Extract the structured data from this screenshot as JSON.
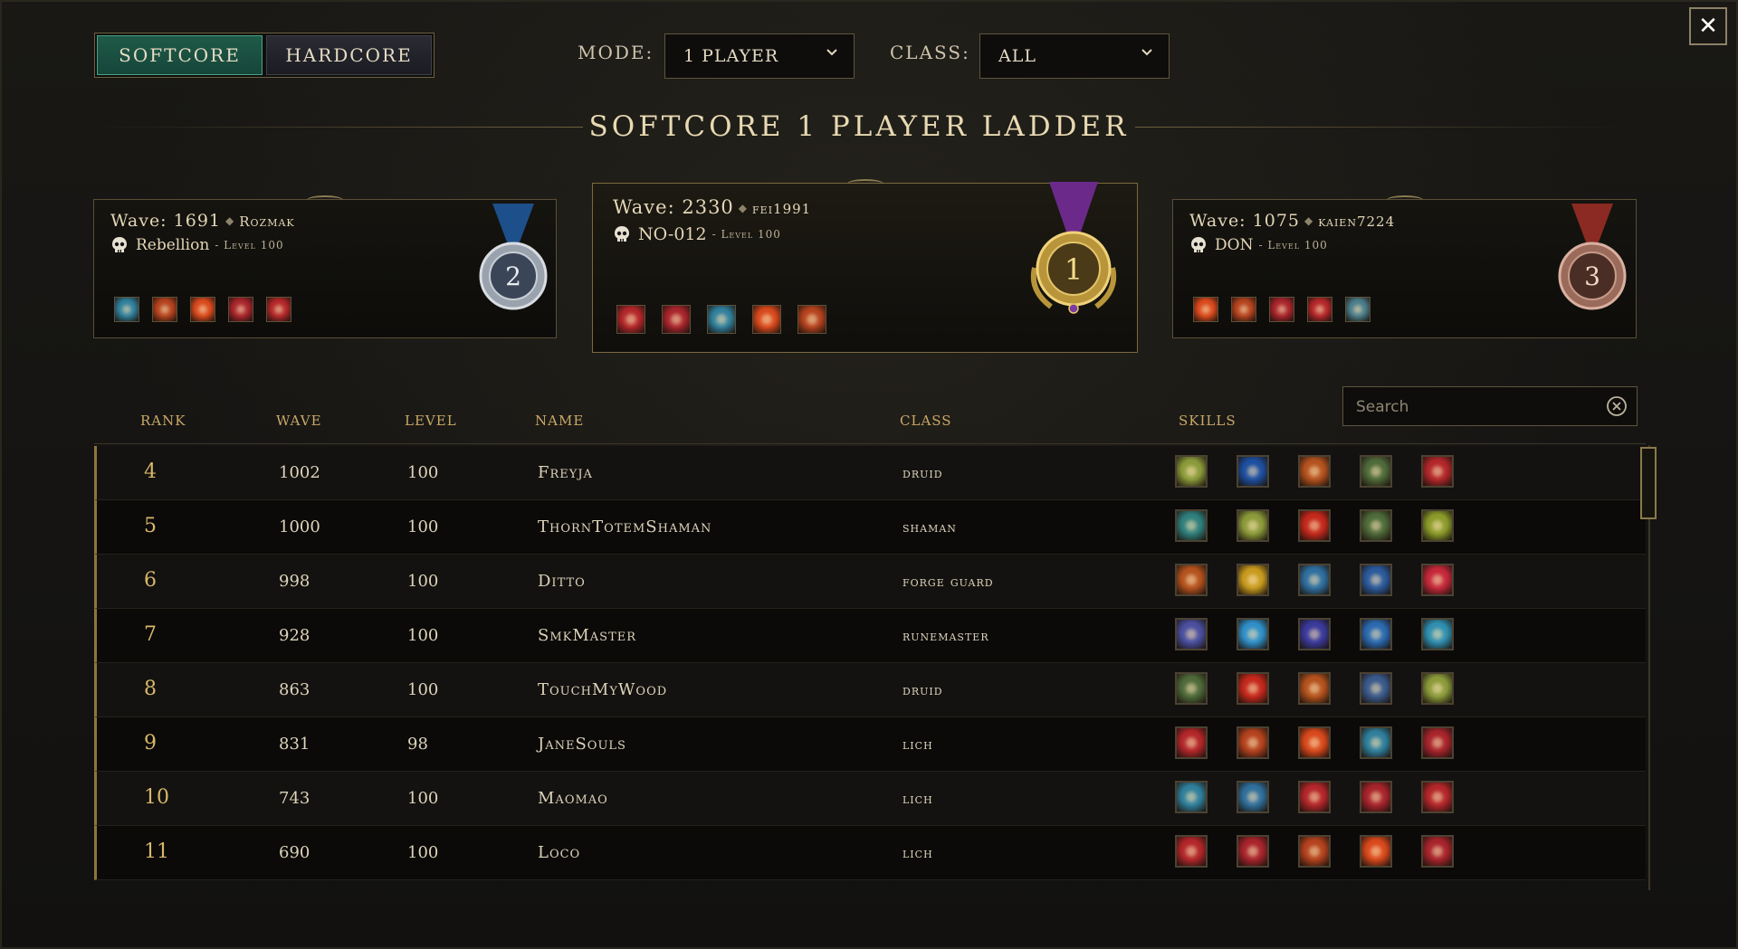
{
  "close_label": "✕",
  "mode_toggle": {
    "softcore": "SOFTCORE",
    "hardcore": "HARDCORE",
    "active": "softcore"
  },
  "filters": {
    "mode": {
      "label": "MODE:",
      "value": "1 PLAYER"
    },
    "class": {
      "label": "CLASS:",
      "value": "ALL"
    }
  },
  "ladder_title": "SOFTCORE 1 PLAYER LADDER",
  "podium": {
    "first": {
      "place": "1",
      "wave_label": "Wave:",
      "wave": "2330",
      "account": "fei1991",
      "character": "NO-012",
      "level": "- Level 100",
      "medal_color": "#6b2a8a",
      "skills": [
        "#b3262a",
        "#a8242c",
        "#2f7f9c",
        "#d8481c",
        "#b4421e"
      ]
    },
    "second": {
      "place": "2",
      "wave_label": "Wave:",
      "wave": "1691",
      "account": "Rozmak",
      "character": "Rebellion",
      "level": "- Level 100",
      "medal_color": "#1d4f8a",
      "skills": [
        "#2f7f9c",
        "#b4421e",
        "#d8481c",
        "#a8242c",
        "#b3262a"
      ]
    },
    "third": {
      "place": "3",
      "wave_label": "Wave:",
      "wave": "1075",
      "account": "kaien7224",
      "character": "DON",
      "level": "- Level 100",
      "medal_color": "#8a2a22",
      "skills": [
        "#d8481c",
        "#b4421e",
        "#a8242c",
        "#b3262a",
        "#4a7c8a"
      ]
    }
  },
  "search": {
    "placeholder": "Search"
  },
  "table": {
    "headers": {
      "rank": "RANK",
      "wave": "WAVE",
      "level": "LEVEL",
      "name": "NAME",
      "class": "CLASS",
      "skills": "SKILLS"
    },
    "rows": [
      {
        "rank": "4",
        "wave": "1002",
        "level": "100",
        "name": "Freyja",
        "class": "druid",
        "skills": [
          "#8a9a3a",
          "#1d4fa0",
          "#b4521e",
          "#4e6a3a",
          "#b3262a"
        ]
      },
      {
        "rank": "5",
        "wave": "1000",
        "level": "100",
        "name": "ThornTotemShaman",
        "class": "shaman",
        "skills": [
          "#2f7f7c",
          "#8a9a3a",
          "#c4281c",
          "#4e6a3a",
          "#8a9a2a"
        ]
      },
      {
        "rank": "6",
        "wave": "998",
        "level": "100",
        "name": "Ditto",
        "class": "forge guard",
        "skills": [
          "#b4521e",
          "#c79a1e",
          "#2f6fa0",
          "#2a5a9c",
          "#c4283a"
        ]
      },
      {
        "rank": "7",
        "wave": "928",
        "level": "100",
        "name": "SmkMaster",
        "class": "runemaster",
        "skills": [
          "#4a4fa0",
          "#2f8fc8",
          "#3a3a9c",
          "#2a6ab0",
          "#2f8fb0"
        ]
      },
      {
        "rank": "8",
        "wave": "863",
        "level": "100",
        "name": "TouchMyWood",
        "class": "druid",
        "skills": [
          "#4e6a3a",
          "#c4281c",
          "#b4521e",
          "#3a5a8c",
          "#8a9a3a"
        ]
      },
      {
        "rank": "9",
        "wave": "831",
        "level": "98",
        "name": "JaneSouls",
        "class": "lich",
        "skills": [
          "#b3262a",
          "#b4421e",
          "#d8481c",
          "#2f7f9c",
          "#a8242c"
        ]
      },
      {
        "rank": "10",
        "wave": "743",
        "level": "100",
        "name": "Maomao",
        "class": "lich",
        "skills": [
          "#2f7f9c",
          "#2f6f9c",
          "#b3262a",
          "#a8242c",
          "#b3262a"
        ]
      },
      {
        "rank": "11",
        "wave": "690",
        "level": "100",
        "name": "Loco",
        "class": "lich",
        "skills": [
          "#b3262a",
          "#a8242c",
          "#b4421e",
          "#d8481c",
          "#a8242c"
        ]
      }
    ]
  }
}
